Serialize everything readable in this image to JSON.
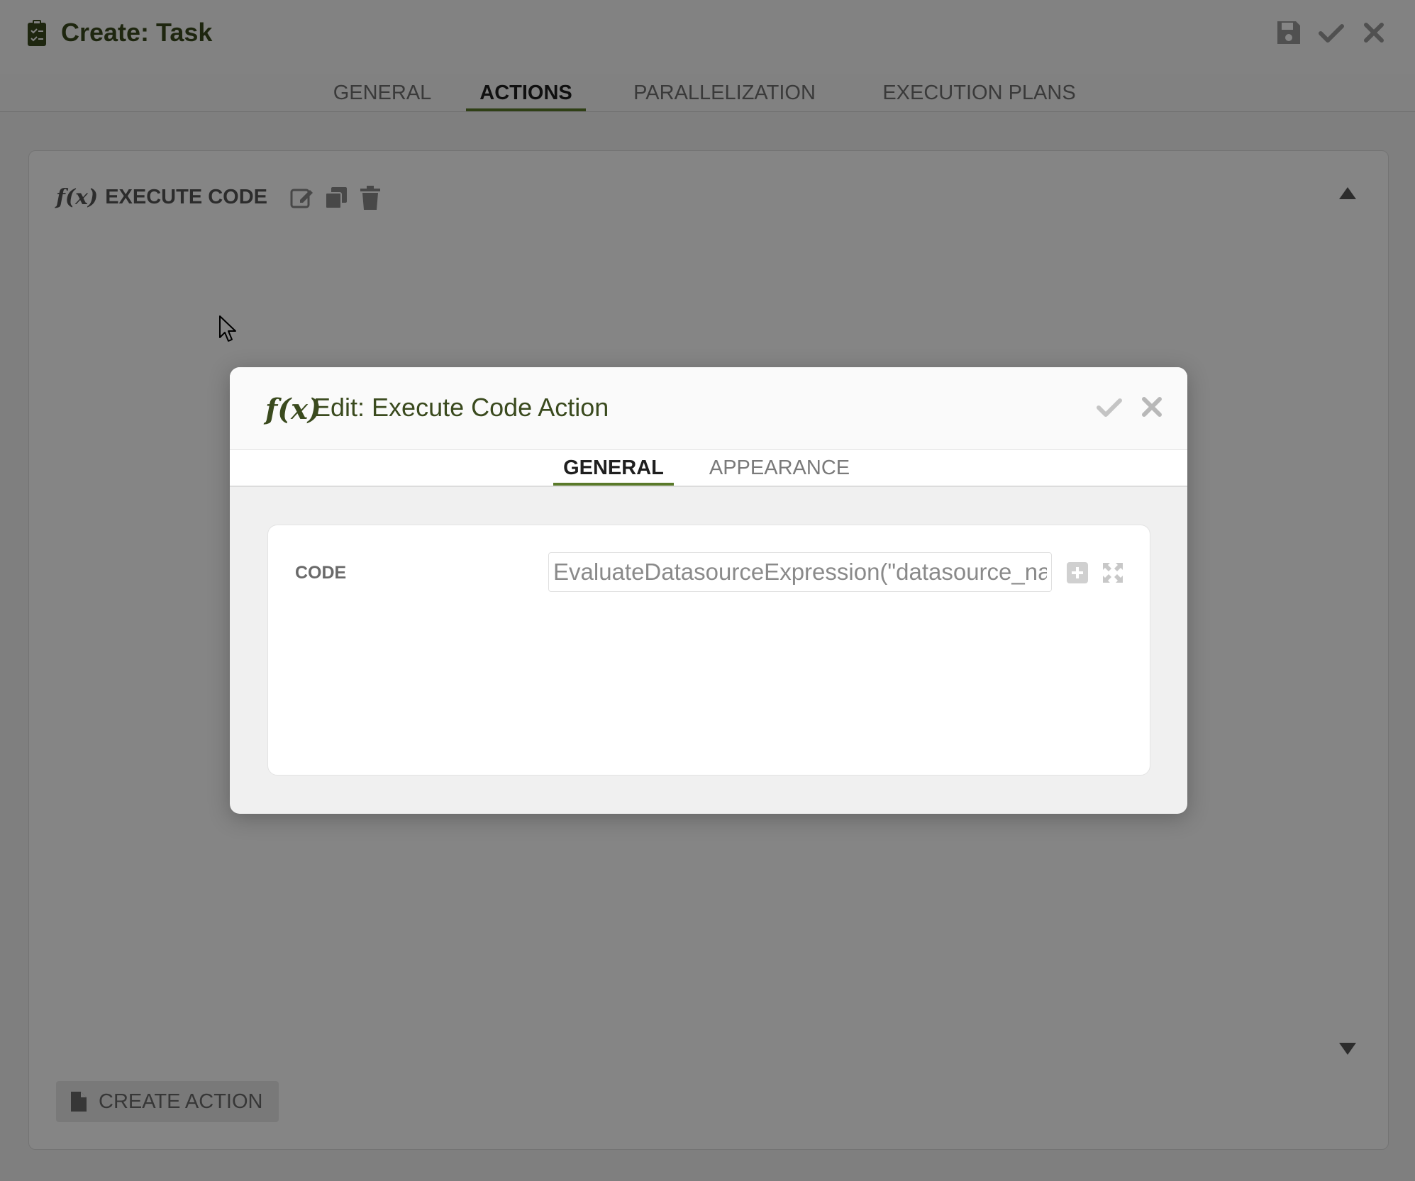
{
  "window": {
    "title": "Create: Task",
    "title_icon": "clipboard-check-icon",
    "actions": [
      "save-icon",
      "check-icon",
      "close-icon"
    ]
  },
  "main_tabs": [
    {
      "label": "GENERAL",
      "active": false
    },
    {
      "label": "ACTIONS",
      "active": true
    },
    {
      "label": "PARALLELIZATION",
      "active": false
    },
    {
      "label": "EXECUTION PLANS",
      "active": false
    }
  ],
  "panel": {
    "action_icon": "f(x)",
    "action_title": "EXECUTE CODE",
    "action_tools": [
      "edit-icon",
      "copy-icon",
      "trash-icon"
    ],
    "create_button_label": "CREATE ACTION"
  },
  "modal": {
    "icon": "f(x)",
    "title": "Edit: Execute Code Action",
    "tabs": [
      {
        "label": "GENERAL",
        "active": true
      },
      {
        "label": "APPEARANCE",
        "active": false
      }
    ],
    "field": {
      "label": "CODE",
      "value": "EvaluateDatasourceExpression(\"datasource_nan"
    }
  },
  "colors": {
    "accent": "#5a7a2a",
    "title_green": "#3a4a1e"
  }
}
